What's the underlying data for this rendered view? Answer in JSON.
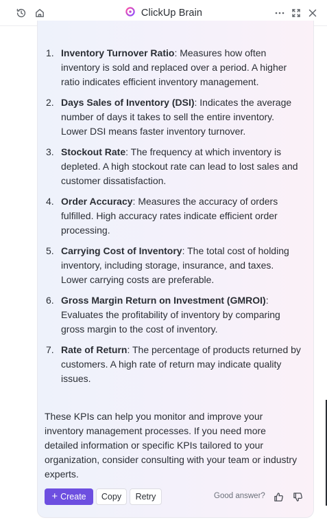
{
  "header": {
    "title": "ClickUp Brain",
    "icons": [
      "history-icon",
      "home-icon",
      "more-icon",
      "expand-icon",
      "close-icon"
    ]
  },
  "kpis": [
    {
      "number": "1.",
      "name": "Inventory Turnover Ratio",
      "description": ": Measures how often inventory is sold and replaced over a period. A higher ratio indicates efficient inventory management."
    },
    {
      "number": "2.",
      "name": "Days Sales of Inventory (DSI)",
      "description": ": Indicates the average number of days it takes to sell the entire inventory. Lower DSI means faster inventory turnover."
    },
    {
      "number": "3.",
      "name": "Stockout Rate",
      "description": ": The frequency at which inventory is depleted. A high stockout rate can lead to lost sales and customer dissatisfaction."
    },
    {
      "number": "4.",
      "name": "Order Accuracy",
      "description": ": Measures the accuracy of orders fulfilled. High accuracy rates indicate efficient order processing."
    },
    {
      "number": "5.",
      "name": "Carrying Cost of Inventory",
      "description": ": The total cost of holding inventory, including storage, insurance, and taxes. Lower carrying costs are preferable."
    },
    {
      "number": "6.",
      "name": "Gross Margin Return on Investment (GMROI)",
      "description": ": Evaluates the profitability of inventory by comparing gross margin to the cost of inventory."
    },
    {
      "number": "7.",
      "name": "Rate of Return",
      "description": ": The percentage of products returned by customers. A high rate of return may indicate quality issues."
    }
  ],
  "summary": "These KPIs can help you monitor and improve your inventory management processes. If you need more detailed information or specific KPIs tailored to your organization, consider consulting with your team or industry experts.",
  "actions": {
    "create_label": "Create",
    "copy_label": "Copy",
    "retry_label": "Retry",
    "feedback_prompt": "Good answer?"
  },
  "colors": {
    "accent": "#6d4fe0",
    "text": "#2a2e34",
    "muted": "#6b7079"
  }
}
